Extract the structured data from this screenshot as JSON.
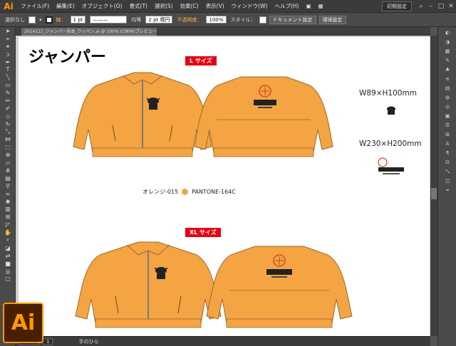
{
  "app": {
    "logo_text": "Ai"
  },
  "menu": [
    "ファイル(F)",
    "編集(E)",
    "オブジェクト(O)",
    "書式(T)",
    "選択(S)",
    "効果(C)",
    "表示(V)",
    "ウィンドウ(W)",
    "ヘルプ(H)"
  ],
  "workspace": {
    "label": "初期設定"
  },
  "control": {
    "selection": "選択なし",
    "stroke_label": "線：",
    "stroke_weight": "1 pt",
    "profile": "均等",
    "brush": "2 pt 楕円",
    "opacity_label": "不透明度：",
    "opacity_value": "100%",
    "style_label": "スタイル：",
    "doc_setup": "ドキュメント設定",
    "prefs": "環境設定"
  },
  "document_tab": {
    "title": "2014111_ジャンパー見本_ワッペン.ai @ 100% (CMYK/プレビュー)"
  },
  "status": {
    "zoom": "100%",
    "page": "1",
    "tool": "手のひら"
  },
  "artwork": {
    "heading": "ジャンパー",
    "l_badge": "L サイズ",
    "xl_badge": "XL サイズ",
    "dim_small": "W89×H100mm",
    "dim_large": "W230×H200mm",
    "color_name": "オレンジ-015",
    "pantone": "PANTONE-164C",
    "jacket_color": "#f4a443",
    "badge_color": "#e60012"
  },
  "badge": {
    "text": "Ai"
  }
}
